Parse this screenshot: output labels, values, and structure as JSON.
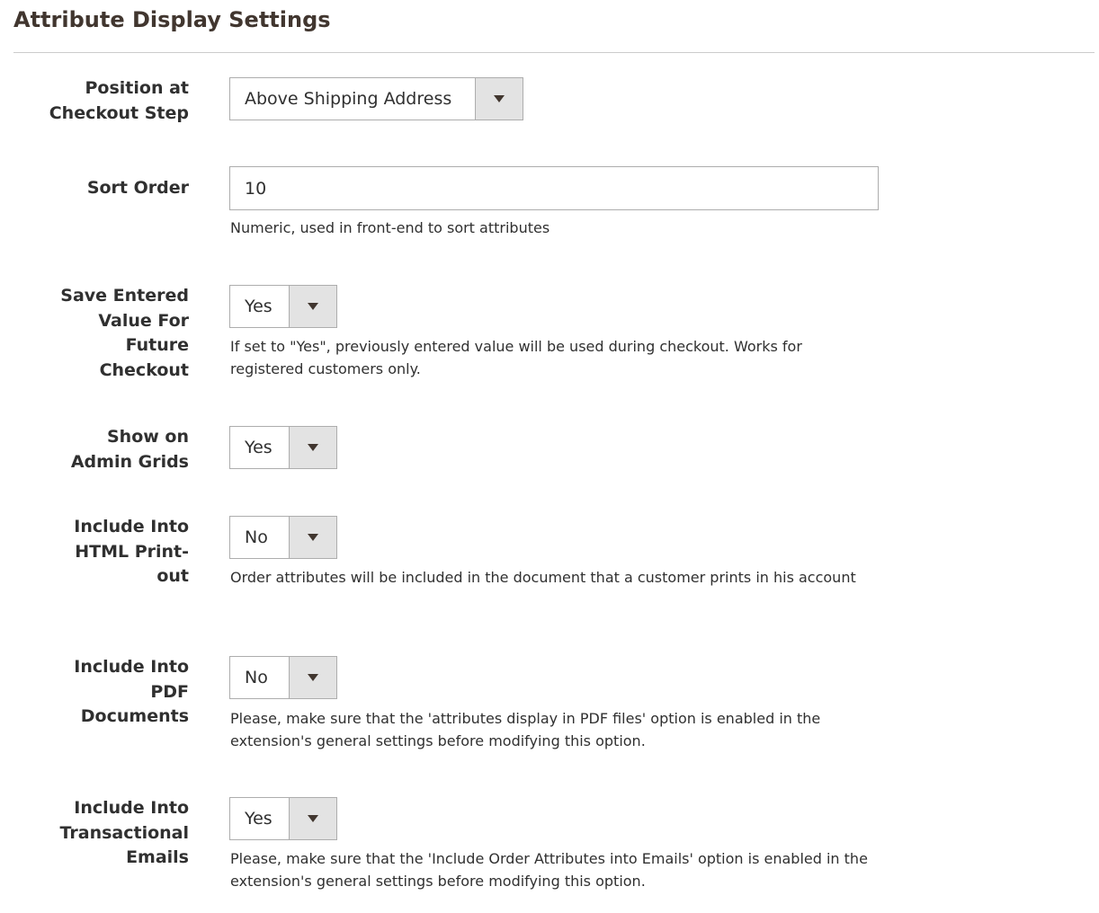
{
  "section": {
    "title": "Attribute Display Settings"
  },
  "fields": {
    "position": {
      "label": "Position at Checkout Step",
      "value": "Above Shipping Address"
    },
    "sort_order": {
      "label": "Sort Order",
      "value": "10",
      "note": "Numeric, used in front-end to sort attributes"
    },
    "save_value": {
      "label": "Save Entered Value For Future Checkout",
      "value": "Yes",
      "note": "If set to \"Yes\", previously entered value will be used during checkout. Works for registered customers only."
    },
    "show_admin_grids": {
      "label": "Show on Admin Grids",
      "value": "Yes"
    },
    "html_print": {
      "label": "Include Into HTML Print-out",
      "value": "No",
      "note": "Order attributes will be included in the document that a customer prints in his account"
    },
    "pdf_documents": {
      "label": "Include Into PDF Documents",
      "value": "No",
      "note": "Please, make sure that the 'attributes display in PDF files' option is enabled in the extension's general settings before modifying this option."
    },
    "transactional_emails": {
      "label": "Include Into Transactional Emails",
      "value": "Yes",
      "note": "Please, make sure that the 'Include Order Attributes into Emails' option is enabled in the extension's general settings before modifying this option."
    }
  }
}
